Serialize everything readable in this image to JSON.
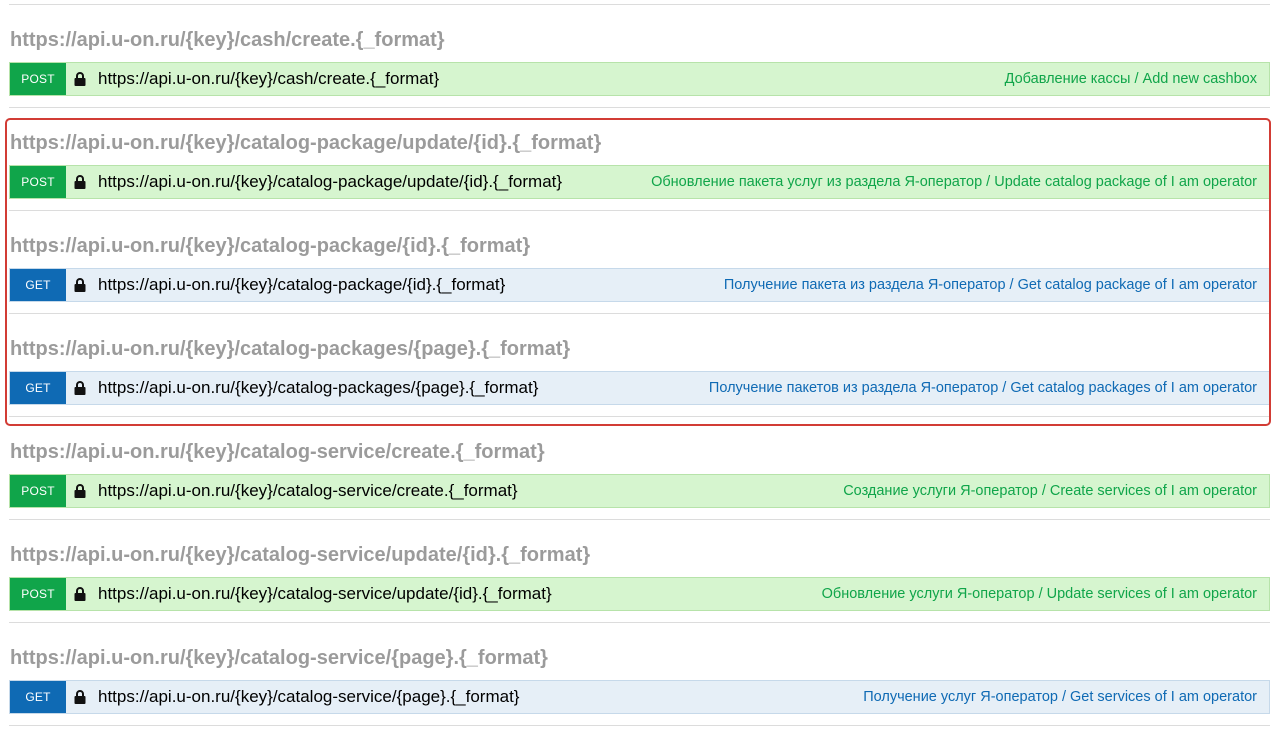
{
  "icons": {
    "lock": "lock-icon"
  },
  "colors": {
    "post_method": "#10a54a",
    "get_method": "#0f6ab4",
    "post_bar": "#d6f5cf",
    "get_bar": "#e6eff7",
    "heading": "#9b9b9b",
    "highlight_border": "#d23c35"
  },
  "endpoints": [
    {
      "heading": "https://api.u-on.ru/{key}/cash/create.{_format}",
      "method": "POST",
      "path": "https://api.u-on.ru/{key}/cash/create.{_format}",
      "description": "Добавление кассы / Add new cashbox"
    },
    {
      "heading": "https://api.u-on.ru/{key}/catalog-package/update/{id}.{_format}",
      "method": "POST",
      "path": "https://api.u-on.ru/{key}/catalog-package/update/{id}.{_format}",
      "description": "Обновление пакета услуг из раздела Я-оператор / Update catalog package of I am operator"
    },
    {
      "heading": "https://api.u-on.ru/{key}/catalog-package/{id}.{_format}",
      "method": "GET",
      "path": "https://api.u-on.ru/{key}/catalog-package/{id}.{_format}",
      "description": "Получение пакета из раздела Я-оператор / Get catalog package of I am operator"
    },
    {
      "heading": "https://api.u-on.ru/{key}/catalog-packages/{page}.{_format}",
      "method": "GET",
      "path": "https://api.u-on.ru/{key}/catalog-packages/{page}.{_format}",
      "description": "Получение пакетов из раздела Я-оператор / Get catalog packages of I am operator"
    },
    {
      "heading": "https://api.u-on.ru/{key}/catalog-service/create.{_format}",
      "method": "POST",
      "path": "https://api.u-on.ru/{key}/catalog-service/create.{_format}",
      "description": "Создание услуги Я-оператор / Create services of I am operator"
    },
    {
      "heading": "https://api.u-on.ru/{key}/catalog-service/update/{id}.{_format}",
      "method": "POST",
      "path": "https://api.u-on.ru/{key}/catalog-service/update/{id}.{_format}",
      "description": "Обновление услуги Я-оператор / Update services of I am operator"
    },
    {
      "heading": "https://api.u-on.ru/{key}/catalog-service/{page}.{_format}",
      "method": "GET",
      "path": "https://api.u-on.ru/{key}/catalog-service/{page}.{_format}",
      "description": "Получение услуг Я-оператор / Get services of I am operator"
    }
  ]
}
